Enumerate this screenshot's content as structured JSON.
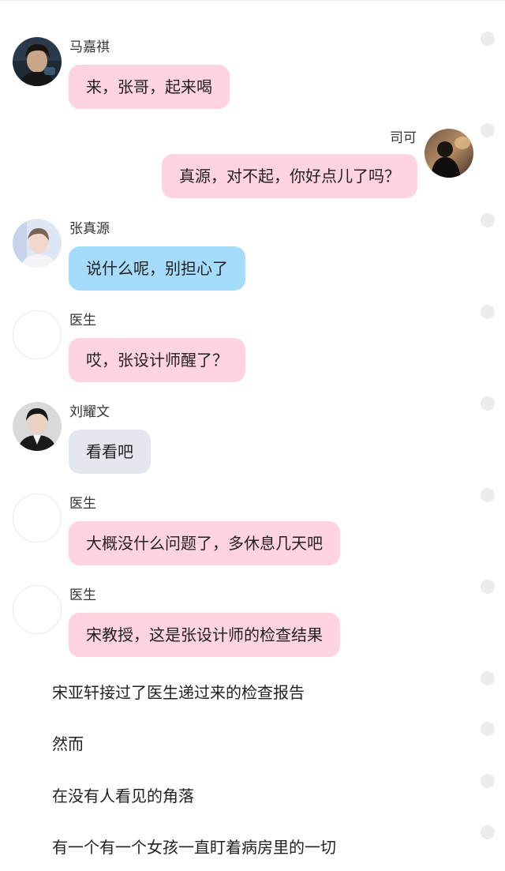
{
  "colors": {
    "bubble_pink": "#ffd3df",
    "bubble_blue": "#a6dcfb",
    "bubble_gray": "#e4e8ee",
    "background": "#ffffff",
    "row_dot": "#ececec"
  },
  "messages": [
    {
      "sender": "马嘉祺",
      "text": "来，张哥，起来喝",
      "side": "left",
      "bubble_color": "pink",
      "avatar": "portrait-photo"
    },
    {
      "sender": "司可",
      "text": "真源，对不起，你好点儿了吗？",
      "side": "right",
      "bubble_color": "pink",
      "avatar": "silhouette-photo"
    },
    {
      "sender": "张真源",
      "text": "说什么呢，别担心了",
      "side": "left",
      "bubble_color": "blue",
      "avatar": "portrait-photo"
    },
    {
      "sender": "医生",
      "text": "哎，张设计师醒了？",
      "side": "left",
      "bubble_color": "pink",
      "avatar": "blank"
    },
    {
      "sender": "刘耀文",
      "text": "看看吧",
      "side": "left",
      "bubble_color": "gray",
      "avatar": "portrait-photo"
    },
    {
      "sender": "医生",
      "text": "大概没什么问题了，多休息几天吧",
      "side": "left",
      "bubble_color": "pink",
      "avatar": "blank"
    },
    {
      "sender": "医生",
      "text": "宋教授，这是张设计师的检查结果",
      "side": "left",
      "bubble_color": "pink",
      "avatar": "blank"
    }
  ],
  "narration": [
    "宋亚轩接过了医生递过来的检查报告",
    "然而",
    "在没有人看见的角落",
    "有一个有一个女孩一直盯着病房里的一切"
  ]
}
